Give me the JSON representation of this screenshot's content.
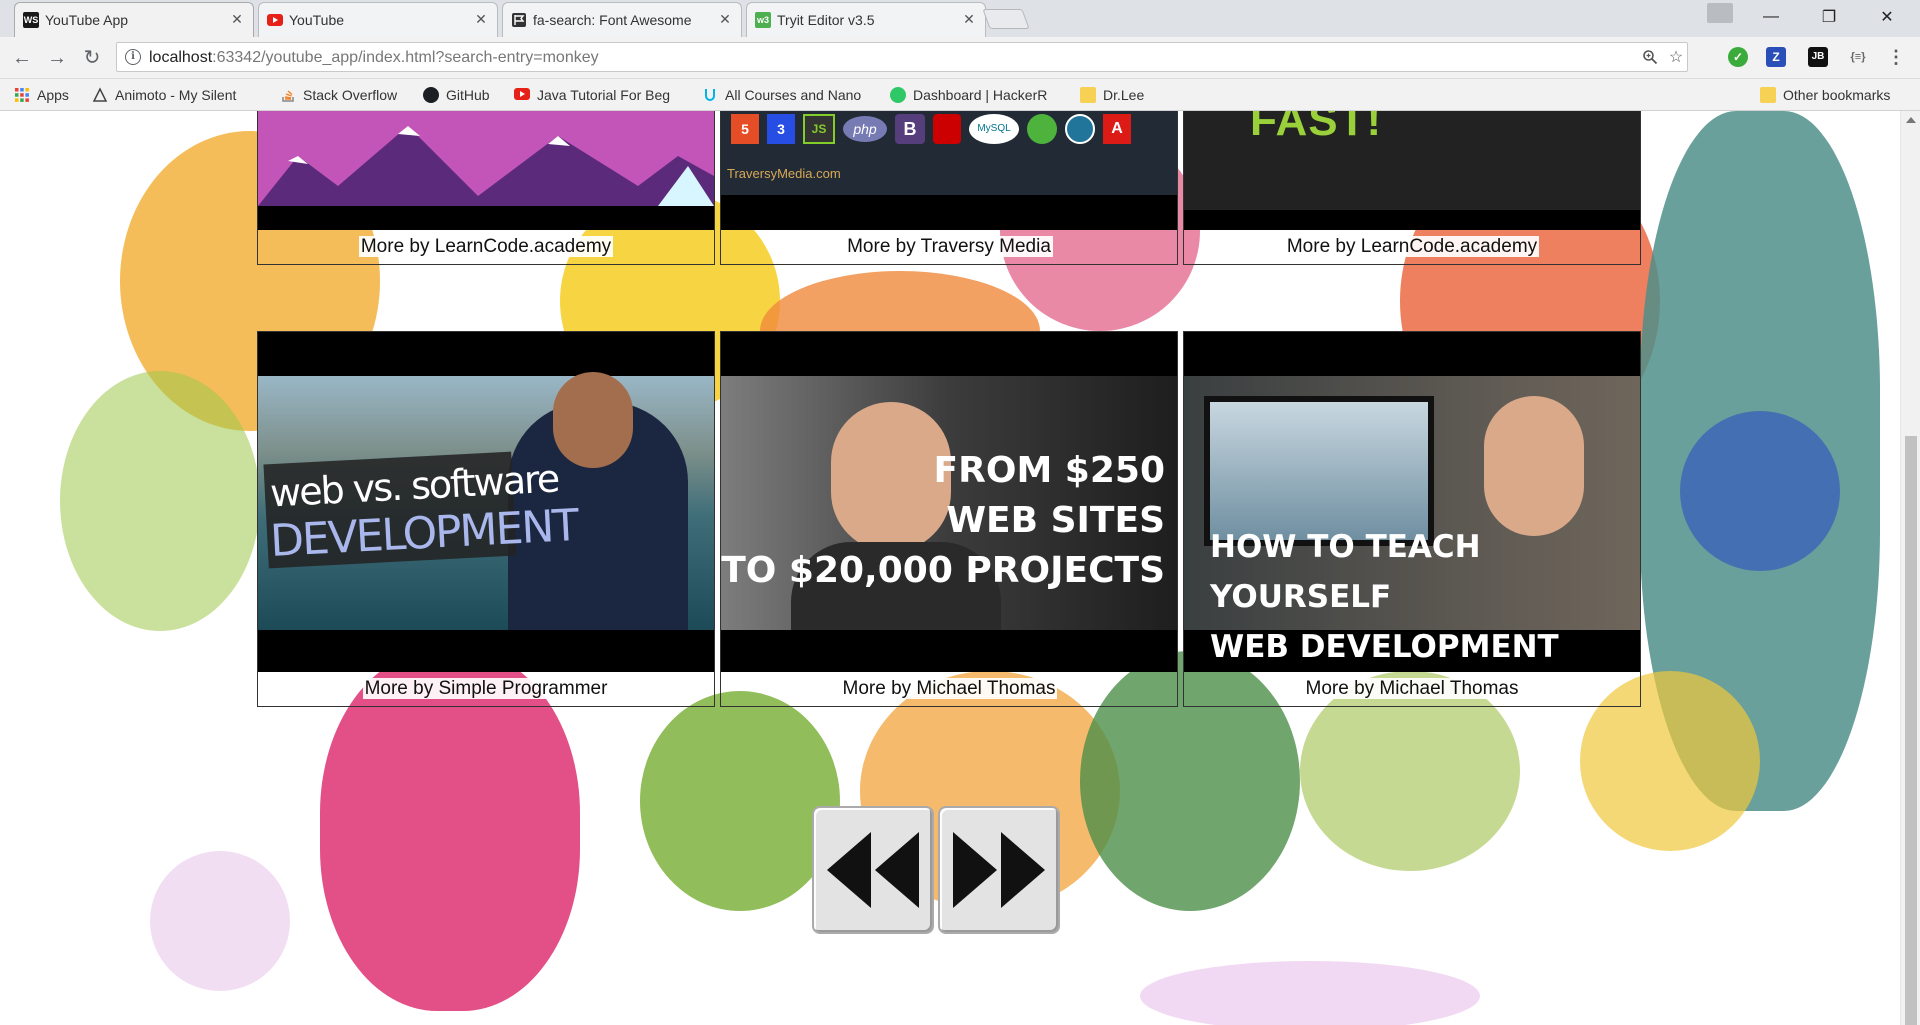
{
  "browser": {
    "tabs": [
      {
        "title": "YouTube App",
        "icon": "webstorm-icon",
        "active": true
      },
      {
        "title": "YouTube",
        "icon": "youtube-icon",
        "active": false
      },
      {
        "title": "fa-search: Font Awesome",
        "icon": "flag-icon",
        "active": false
      },
      {
        "title": "Tryit Editor v3.5",
        "icon": "w3schools-icon",
        "active": false
      }
    ],
    "url_host": "localhost",
    "url_rest": ":63342/youtube_app/index.html?search-entry=monkey",
    "bookmarks": [
      {
        "label": "Apps",
        "icon": "apps-grid-icon"
      },
      {
        "label": "Animoto - My Silent",
        "icon": "animoto-icon"
      },
      {
        "label": "Stack Overflow",
        "icon": "stackoverflow-icon"
      },
      {
        "label": "GitHub",
        "icon": "github-icon"
      },
      {
        "label": "Java Tutorial For Beg",
        "icon": "youtube-icon"
      },
      {
        "label": "All Courses and Nano",
        "icon": "udacity-icon"
      },
      {
        "label": "Dashboard | HackerR",
        "icon": "hackerrank-icon"
      },
      {
        "label": "Dr.Lee",
        "icon": "folder-icon"
      }
    ],
    "other_bookmarks": "Other bookmarks"
  },
  "page": {
    "top_row": [
      {
        "caption": "More by LearnCode.academy"
      },
      {
        "caption": "More by Traversy Media",
        "thumb_text": "TraversyMedia.com",
        "logos": [
          "5",
          "3",
          "JS",
          "php",
          "B",
          "MySQL",
          "A"
        ]
      },
      {
        "caption": "More by LearnCode.academy",
        "thumb_text": "FAST!"
      }
    ],
    "bottom_row": [
      {
        "caption": "More by Simple Programmer",
        "thumb_line1": "web vs. software",
        "thumb_line2": "DEVELOPMENT"
      },
      {
        "caption": "More by Michael Thomas",
        "thumb_lines": [
          "FROM $250",
          "WEB SITES",
          "TO $20,000 PROJECTS"
        ]
      },
      {
        "caption": "More by Michael Thomas",
        "thumb_lines": [
          "HOW TO TEACH YOURSELF",
          "WEB DEVELOPMENT"
        ]
      }
    ],
    "pager": {
      "prev_icon": "rewind-icon",
      "next_icon": "fast-forward-icon"
    }
  }
}
